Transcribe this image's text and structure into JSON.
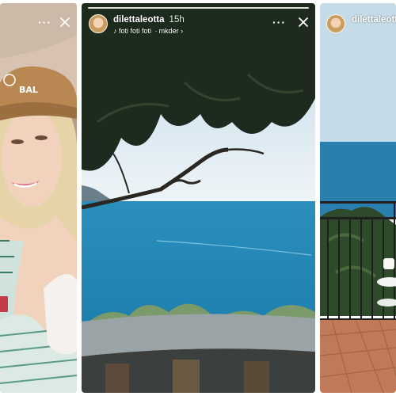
{
  "stories": {
    "middle": {
      "username": "dilettaleotta",
      "time_ago": "15h",
      "music_title": "foti foti foti",
      "music_artist": "mkder",
      "music_icon": "music-note-icon",
      "more_icon": "more-dots-icon",
      "close_icon": "close-icon"
    },
    "right": {
      "username": "dilettaleotta"
    },
    "left": {
      "more_icon": "more-dots-icon",
      "close_icon": "close-icon"
    }
  },
  "colors": {
    "sea": "#1e86b3",
    "sky": "#dbe9f3",
    "tree": "#1c2b1e",
    "floor": "#c07a5a"
  }
}
